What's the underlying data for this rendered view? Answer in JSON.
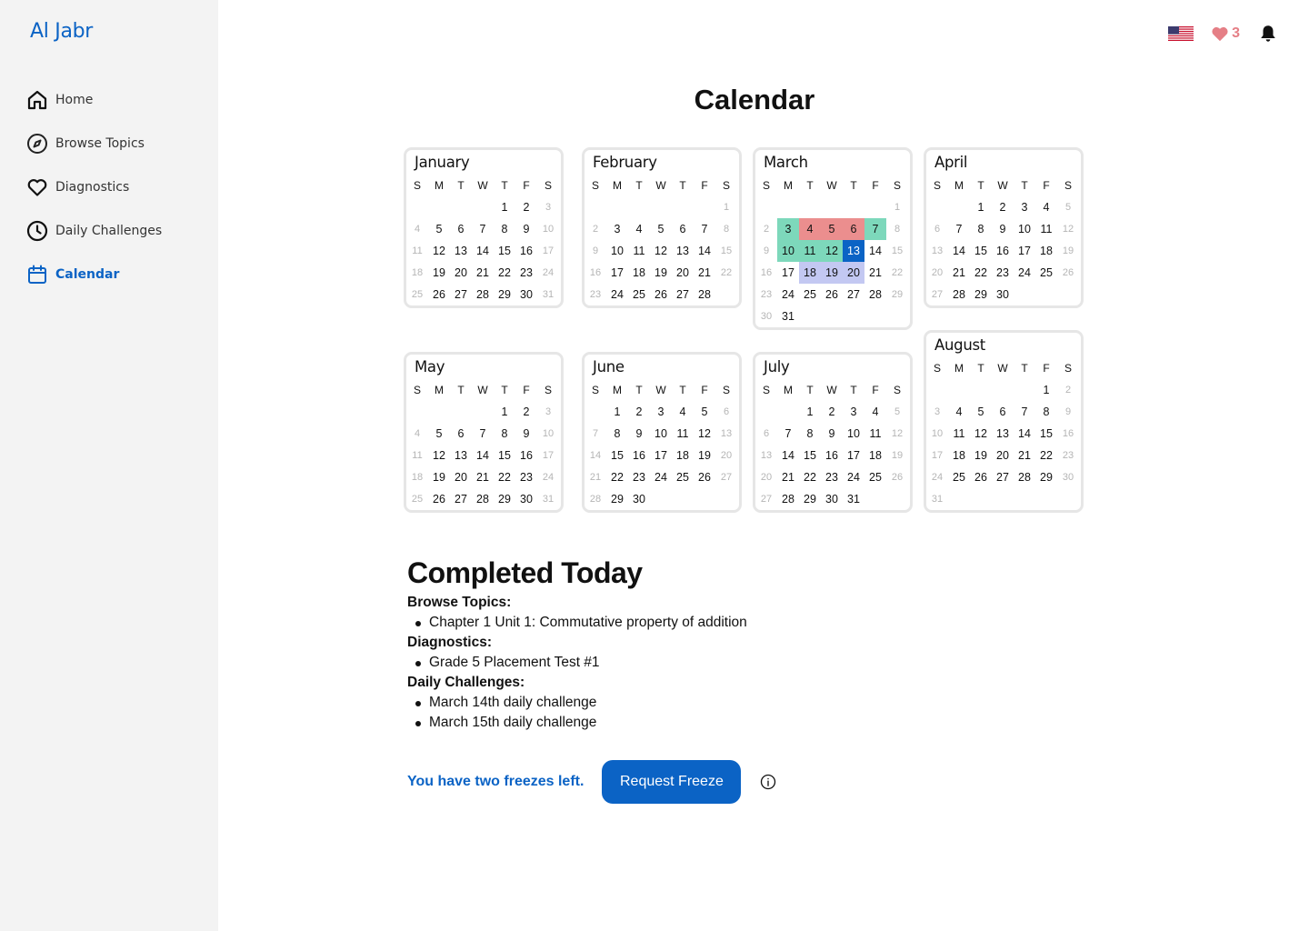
{
  "sidebar": {
    "brand": "Al Jabr",
    "items": [
      {
        "label": "Home",
        "icon": "home-icon"
      },
      {
        "label": "Browse Topics",
        "icon": "compass-icon"
      },
      {
        "label": "Diagnostics",
        "icon": "heart-icon"
      },
      {
        "label": "Daily Challenges",
        "icon": "clock-icon"
      },
      {
        "label": "Calendar",
        "icon": "calendar-icon",
        "active": true
      }
    ]
  },
  "header": {
    "language": "us-flag-icon",
    "hearts": "3"
  },
  "title": "Calendar",
  "weekdays": [
    "S",
    "M",
    "T",
    "W",
    "T",
    "F",
    "S"
  ],
  "months": [
    {
      "name": "January",
      "start": 4,
      "days": 31
    },
    {
      "name": "February",
      "start": 6,
      "days": 28
    },
    {
      "name": "March",
      "start": 6,
      "days": 31,
      "green": [
        3,
        7,
        10,
        11,
        12
      ],
      "red": [
        4,
        5,
        6
      ],
      "lavender": [
        18,
        19,
        20
      ],
      "today": 13
    },
    {
      "name": "April",
      "start": 2,
      "days": 30
    },
    {
      "name": "May",
      "start": 4,
      "days": 31
    },
    {
      "name": "June",
      "start": 1,
      "days": 30
    },
    {
      "name": "July",
      "start": 2,
      "days": 31
    },
    {
      "name": "August",
      "start": 5,
      "days": 31
    }
  ],
  "completed": {
    "heading": "Completed Today",
    "categories": [
      {
        "title": "Browse Topics:",
        "items": [
          "Chapter 1 Unit 1: Commutative property of addition"
        ]
      },
      {
        "title": "Diagnostics:",
        "items": [
          "Grade 5 Placement Test #1"
        ]
      },
      {
        "title": "Daily Challenges:",
        "items": [
          "March 14th daily challenge",
          "March 15th daily challenge"
        ]
      }
    ]
  },
  "freeze": {
    "text": "You have two freezes left.",
    "button": "Request Freeze"
  },
  "colors": {
    "accent": "#0b63c5",
    "green": "#7dd8bb",
    "red": "#eb8e8e",
    "lavender": "#c3c8f2",
    "heart": "#e57f86"
  }
}
